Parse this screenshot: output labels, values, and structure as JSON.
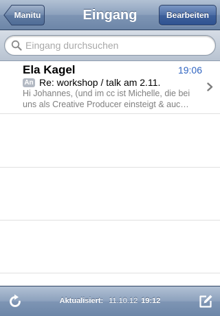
{
  "navbar": {
    "back_label": "Manitu",
    "title": "Eingang",
    "edit_label": "Bearbeiten"
  },
  "search": {
    "placeholder": "Eingang durchsuchen"
  },
  "messages": [
    {
      "sender": "Ela Kagel",
      "time": "19:06",
      "badge": "An",
      "subject": "Re: workshop / talk am 2.11.",
      "preview": "Hi Johannes, (und im cc ist Michelle, die bei uns als Creative Producer einsteigt & auc…"
    }
  ],
  "toolbar": {
    "updated_label": "Aktualisiert:",
    "updated_date": "11.10.12",
    "updated_time": "19:12"
  },
  "icons": {
    "back": "back-arrow-button",
    "search": "search-icon",
    "chevron": "chevron-right-icon",
    "refresh": "refresh-icon",
    "compose": "compose-icon"
  },
  "colors": {
    "bar_top": "#b2c1d4",
    "bar_bottom": "#6d86a8",
    "edit_button": "#3e609b",
    "time_blue": "#2f64c1",
    "preview_gray": "#7f7f7f"
  }
}
